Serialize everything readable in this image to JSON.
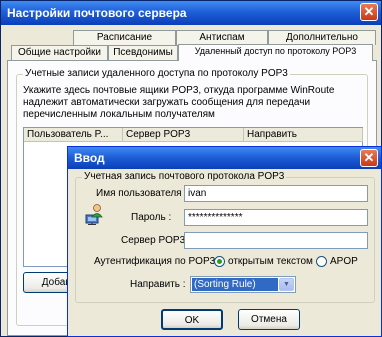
{
  "main_window": {
    "title": "Настройки почтового сервера",
    "tabs_row1": [
      "Расписание",
      "Антиспам",
      "Дополнительно"
    ],
    "tabs_row2": [
      "Общие настройки",
      "Псевдонимы",
      "Удаленный доступ по протоколу POP3"
    ],
    "group_label": "Учетные записи удаленного доступа по протоколу POP3",
    "description": [
      "Укажите здесь почтовые ящики POP3, откуда программе WinRoute",
      "надлежит автоматически загружать сообщения для передачи",
      "перечисленным локальным получателям"
    ],
    "columns": [
      "Пользователь P...",
      "Сервер POP3",
      "Направить"
    ],
    "add_button": "Добави"
  },
  "dialog": {
    "title": "Ввод",
    "group_label": "Учетная запись почтового протокола POP3",
    "username_label": "Имя пользователя :",
    "username_value": "ivan",
    "password_label": "Пароль :",
    "password_value": "**************",
    "server_label": "Сервер POP3 :",
    "server_value": "",
    "auth_label": "Аутентификация по POP3",
    "auth_options": [
      "открытым текстом",
      "APOP"
    ],
    "auth_selected": "открытым текстом",
    "forward_label": "Направить :",
    "forward_value": "(Sorting Rule)",
    "ok_label": "OK",
    "cancel_label": "Отмена"
  },
  "icons": {
    "close": "close-icon",
    "user": "user-network-icon",
    "dropdown": "chevron-down-icon"
  }
}
